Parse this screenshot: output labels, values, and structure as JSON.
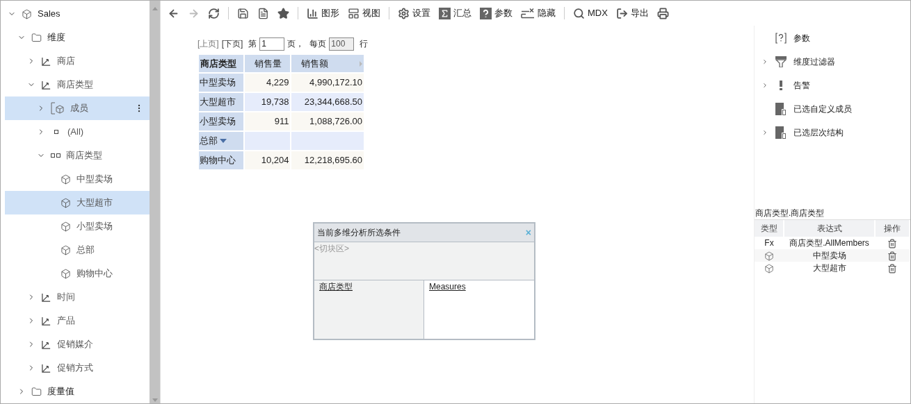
{
  "tree": [
    {
      "label": "Sales",
      "kind": "cube",
      "expanded": true,
      "selected": false,
      "children": [
        {
          "label": "维度",
          "kind": "folder",
          "expanded": true,
          "selected": false,
          "children": [
            {
              "label": "商店",
              "kind": "hierarchy",
              "expanded": false,
              "selected": false
            },
            {
              "label": "商店类型",
              "kind": "hierarchy",
              "expanded": true,
              "selected": false,
              "children": [
                {
                  "label": "成员",
                  "kind": "members",
                  "expanded": false,
                  "selected": true
                },
                {
                  "label": "(All)",
                  "kind": "level1",
                  "expanded": false,
                  "selected": false
                },
                {
                  "label": "商店类型",
                  "kind": "level2",
                  "expanded": true,
                  "selected": false,
                  "children": [
                    {
                      "label": "中型卖场",
                      "kind": "cube",
                      "selected": false
                    },
                    {
                      "label": "大型超市",
                      "kind": "cube",
                      "selected": true
                    },
                    {
                      "label": "小型卖场",
                      "kind": "cube",
                      "selected": false
                    },
                    {
                      "label": "总部",
                      "kind": "cube",
                      "selected": false
                    },
                    {
                      "label": "购物中心",
                      "kind": "cube",
                      "selected": false
                    }
                  ]
                }
              ]
            },
            {
              "label": "时间",
              "kind": "hierarchy",
              "expanded": false,
              "selected": false
            },
            {
              "label": "产品",
              "kind": "hierarchy",
              "expanded": false,
              "selected": false
            },
            {
              "label": "促销媒介",
              "kind": "hierarchy",
              "expanded": false,
              "selected": false
            },
            {
              "label": "促销方式",
              "kind": "hierarchy",
              "expanded": false,
              "selected": false
            }
          ]
        },
        {
          "label": "度量值",
          "kind": "folder",
          "expanded": false,
          "selected": false
        }
      ]
    }
  ],
  "toolbar": [
    {
      "kind": "back",
      "disabled": false
    },
    {
      "kind": "forward",
      "disabled": true
    },
    {
      "kind": "refresh",
      "disabled": false
    },
    {
      "kind": "divider"
    },
    {
      "kind": "save",
      "disabled": false
    },
    {
      "kind": "saveas",
      "disabled": false
    },
    {
      "kind": "star",
      "disabled": false
    },
    {
      "kind": "divider"
    },
    {
      "kind": "chart",
      "label": "图形",
      "disabled": false
    },
    {
      "kind": "view",
      "label": "视图",
      "disabled": false
    },
    {
      "kind": "divider"
    },
    {
      "kind": "settings",
      "label": "设置",
      "disabled": false
    },
    {
      "kind": "sum",
      "label": "汇总",
      "disabled": false
    },
    {
      "kind": "param",
      "label": "参数",
      "disabled": false
    },
    {
      "kind": "hide",
      "label": "隐藏",
      "disabled": false
    },
    {
      "kind": "divider"
    },
    {
      "kind": "search",
      "label": "MDX",
      "disabled": false
    },
    {
      "kind": "export",
      "label": "导出",
      "disabled": false
    },
    {
      "kind": "print",
      "disabled": false
    }
  ],
  "pager": {
    "prev": "[上页]",
    "next": "[下页]",
    "page_prefix": "第",
    "page": "1",
    "page_suffix": "页，",
    "per_page_prefix": "每页",
    "per_page": "100",
    "per_page_suffix": "行"
  },
  "pivot": {
    "columns": [
      "商店类型",
      "销售量",
      "销售额"
    ],
    "rows": [
      {
        "cells": [
          "中型卖场",
          "4,229",
          "4,990,172.10"
        ],
        "dropdown": false
      },
      {
        "cells": [
          "大型超市",
          "19,738",
          "23,344,668.50"
        ],
        "dropdown": false
      },
      {
        "cells": [
          "小型卖场",
          "911",
          "1,088,726.00"
        ],
        "dropdown": false
      },
      {
        "cells": [
          "总部",
          "",
          ""
        ],
        "dropdown": true
      },
      {
        "cells": [
          "购物中心",
          "10,204",
          "12,218,695.60"
        ],
        "dropdown": false
      }
    ]
  },
  "dialog": {
    "title": "当前多维分析所选条件",
    "close": "×",
    "slicer": "<切块区>",
    "rows_link": "商店类型",
    "columns_link": "Measures"
  },
  "right_panel": {
    "items": [
      {
        "label": "参数",
        "kind": "param",
        "expandable": false
      },
      {
        "label": "维度过滤器",
        "kind": "filter",
        "expandable": true
      },
      {
        "label": "告警",
        "kind": "alert",
        "expandable": true
      },
      {
        "label": "已选自定义成员",
        "kind": "doc",
        "expandable": false
      },
      {
        "label": "已选层次结构",
        "kind": "doc",
        "expandable": true
      }
    ],
    "selection_title": "商店类型.商店类型",
    "table": {
      "columns": [
        "类型",
        "表达式",
        "操作"
      ],
      "rows": [
        {
          "kind": "formula",
          "type_label": "Fx",
          "expression": "商店类型.AllMembers"
        },
        {
          "kind": "member",
          "expression": "中型卖场"
        },
        {
          "kind": "member",
          "expression": "大型超市"
        }
      ]
    }
  }
}
